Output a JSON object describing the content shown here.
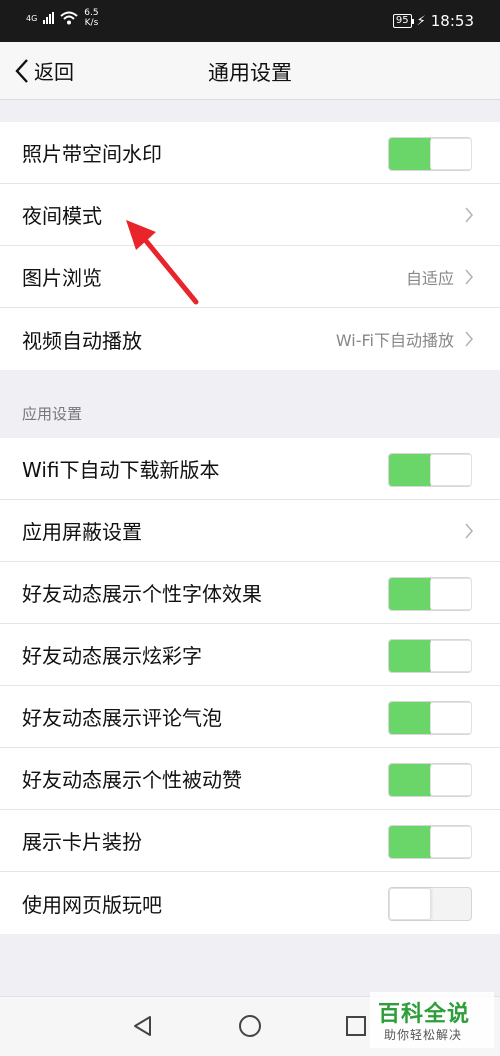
{
  "status_bar": {
    "network": "4G",
    "speed_value": "6.5",
    "speed_unit": "K/s",
    "battery": "95",
    "time": "18:53"
  },
  "nav": {
    "back_label": "返回",
    "title": "通用设置"
  },
  "group1": {
    "rows": [
      {
        "label": "照片带空间水印",
        "type": "toggle",
        "on": true
      },
      {
        "label": "夜间模式",
        "type": "link"
      },
      {
        "label": "图片浏览",
        "type": "link",
        "value": "自适应"
      },
      {
        "label": "视频自动播放",
        "type": "link",
        "value": "Wi-Fi下自动播放"
      }
    ]
  },
  "section_app": {
    "header": "应用设置",
    "rows": [
      {
        "label": "Wifi下自动下载新版本",
        "type": "toggle",
        "on": true
      },
      {
        "label": "应用屏蔽设置",
        "type": "link"
      },
      {
        "label": "好友动态展示个性字体效果",
        "type": "toggle",
        "on": true
      },
      {
        "label": "好友动态展示炫彩字",
        "type": "toggle",
        "on": true
      },
      {
        "label": "好友动态展示评论气泡",
        "type": "toggle",
        "on": true
      },
      {
        "label": "好友动态展示个性被动赞",
        "type": "toggle",
        "on": true
      },
      {
        "label": "展示卡片装扮",
        "type": "toggle",
        "on": true
      },
      {
        "label": "使用网页版玩吧",
        "type": "toggle",
        "on": false
      }
    ]
  },
  "bottom_nav": {
    "icons": [
      "back-triangle-icon",
      "home-circle-icon",
      "recents-square-icon"
    ]
  },
  "watermark": {
    "title": "百科全说",
    "subtitle": "助你轻松解决"
  },
  "colors": {
    "toggle_on": "#6ad66a",
    "annotation_arrow": "#e8252b",
    "status_bar_bg": "#1a1a1a",
    "page_bg": "#efeff4"
  }
}
